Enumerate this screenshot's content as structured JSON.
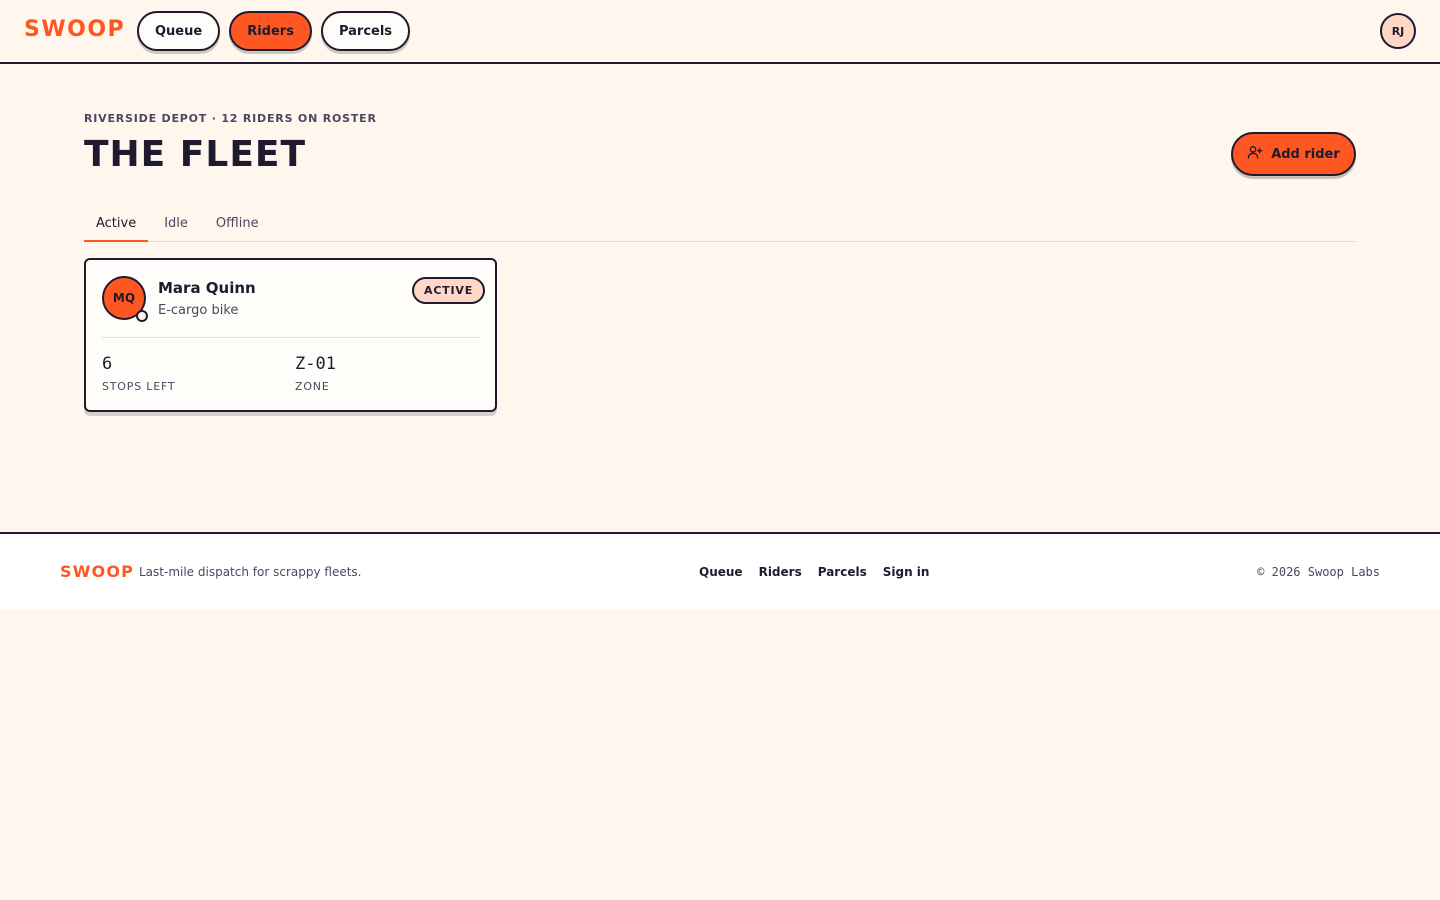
{
  "brand": {
    "name": "SWOOP",
    "accent": "#ff5722",
    "ink": "#1f1a2e"
  },
  "header": {
    "nav": [
      {
        "label": "Queue",
        "active": false
      },
      {
        "label": "Riders",
        "active": true
      },
      {
        "label": "Parcels",
        "active": false
      }
    ],
    "user_initials": "RJ"
  },
  "main": {
    "eyebrow": "RIVERSIDE DEPOT · 12 RIDERS ON ROSTER",
    "title": "THE FLEET",
    "add_button": {
      "label": "Add rider",
      "icon": "user-plus-icon"
    },
    "tabs": [
      {
        "label": "Active",
        "active": true
      },
      {
        "label": "Idle",
        "active": false
      },
      {
        "label": "Offline",
        "active": false
      }
    ],
    "riders": [
      {
        "initials": "MQ",
        "name": "Mara Quinn",
        "vehicle": "E-cargo bike",
        "status": "ACTIVE",
        "stats": [
          {
            "value": "6",
            "label": "STOPS LEFT"
          },
          {
            "value": "Z-01",
            "label": "ZONE"
          }
        ]
      }
    ]
  },
  "footer": {
    "logo": "SWOOP",
    "tagline": "Last-mile dispatch for scrappy fleets.",
    "links": [
      "Queue",
      "Riders",
      "Parcels",
      "Sign in"
    ],
    "copyright": "© 2026 Swoop Labs"
  }
}
